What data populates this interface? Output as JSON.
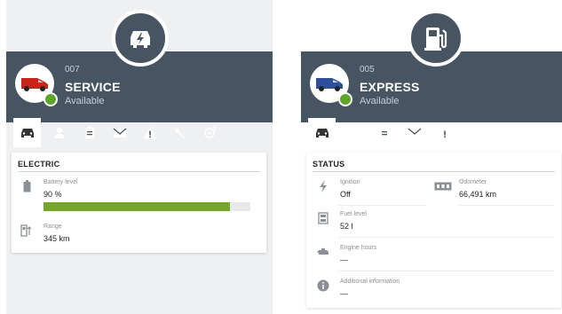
{
  "colors": {
    "header": "#475461",
    "available": "#5fa52a",
    "battery": "#74a62a"
  },
  "cards": [
    {
      "badge_icon": "ev-charging-icon",
      "vehicle_id": "007",
      "vehicle_name": "SERVICE",
      "vehicle_status": "Available",
      "vehicle_color": "#c8241b",
      "tabs": [
        "car-icon",
        "driver-icon",
        "clipboard-icon",
        "envelope-icon",
        "warning-icon",
        "wrench-icon",
        "location-pin-icon"
      ],
      "active_tab": 0,
      "panel": {
        "title": "ELECTRIC",
        "battery_label": "Battery level",
        "battery_value": "90 %",
        "battery_fraction": 0.9,
        "range_label": "Range",
        "range_value": "345 km"
      }
    },
    {
      "badge_icon": "fuel-pump-icon",
      "vehicle_id": "005",
      "vehicle_name": "EXPRESS",
      "vehicle_status": "Available",
      "vehicle_color": "#2d4f9c",
      "tabs": [
        "car-icon",
        "driver-icon",
        "clipboard-icon",
        "envelope-icon",
        "warning-icon",
        "wrench-icon",
        "location-pin-icon"
      ],
      "active_tab": 0,
      "panel": {
        "title": "STATUS",
        "ignition_label": "Ignition",
        "ignition_value": "Off",
        "odometer_label": "Odometer",
        "odometer_value": "66,491 km",
        "fuel_label": "Fuel level",
        "fuel_value": "52 l",
        "engine_label": "Engine hours",
        "engine_value": "—",
        "info_label": "Additional information",
        "info_value": "—"
      }
    }
  ]
}
